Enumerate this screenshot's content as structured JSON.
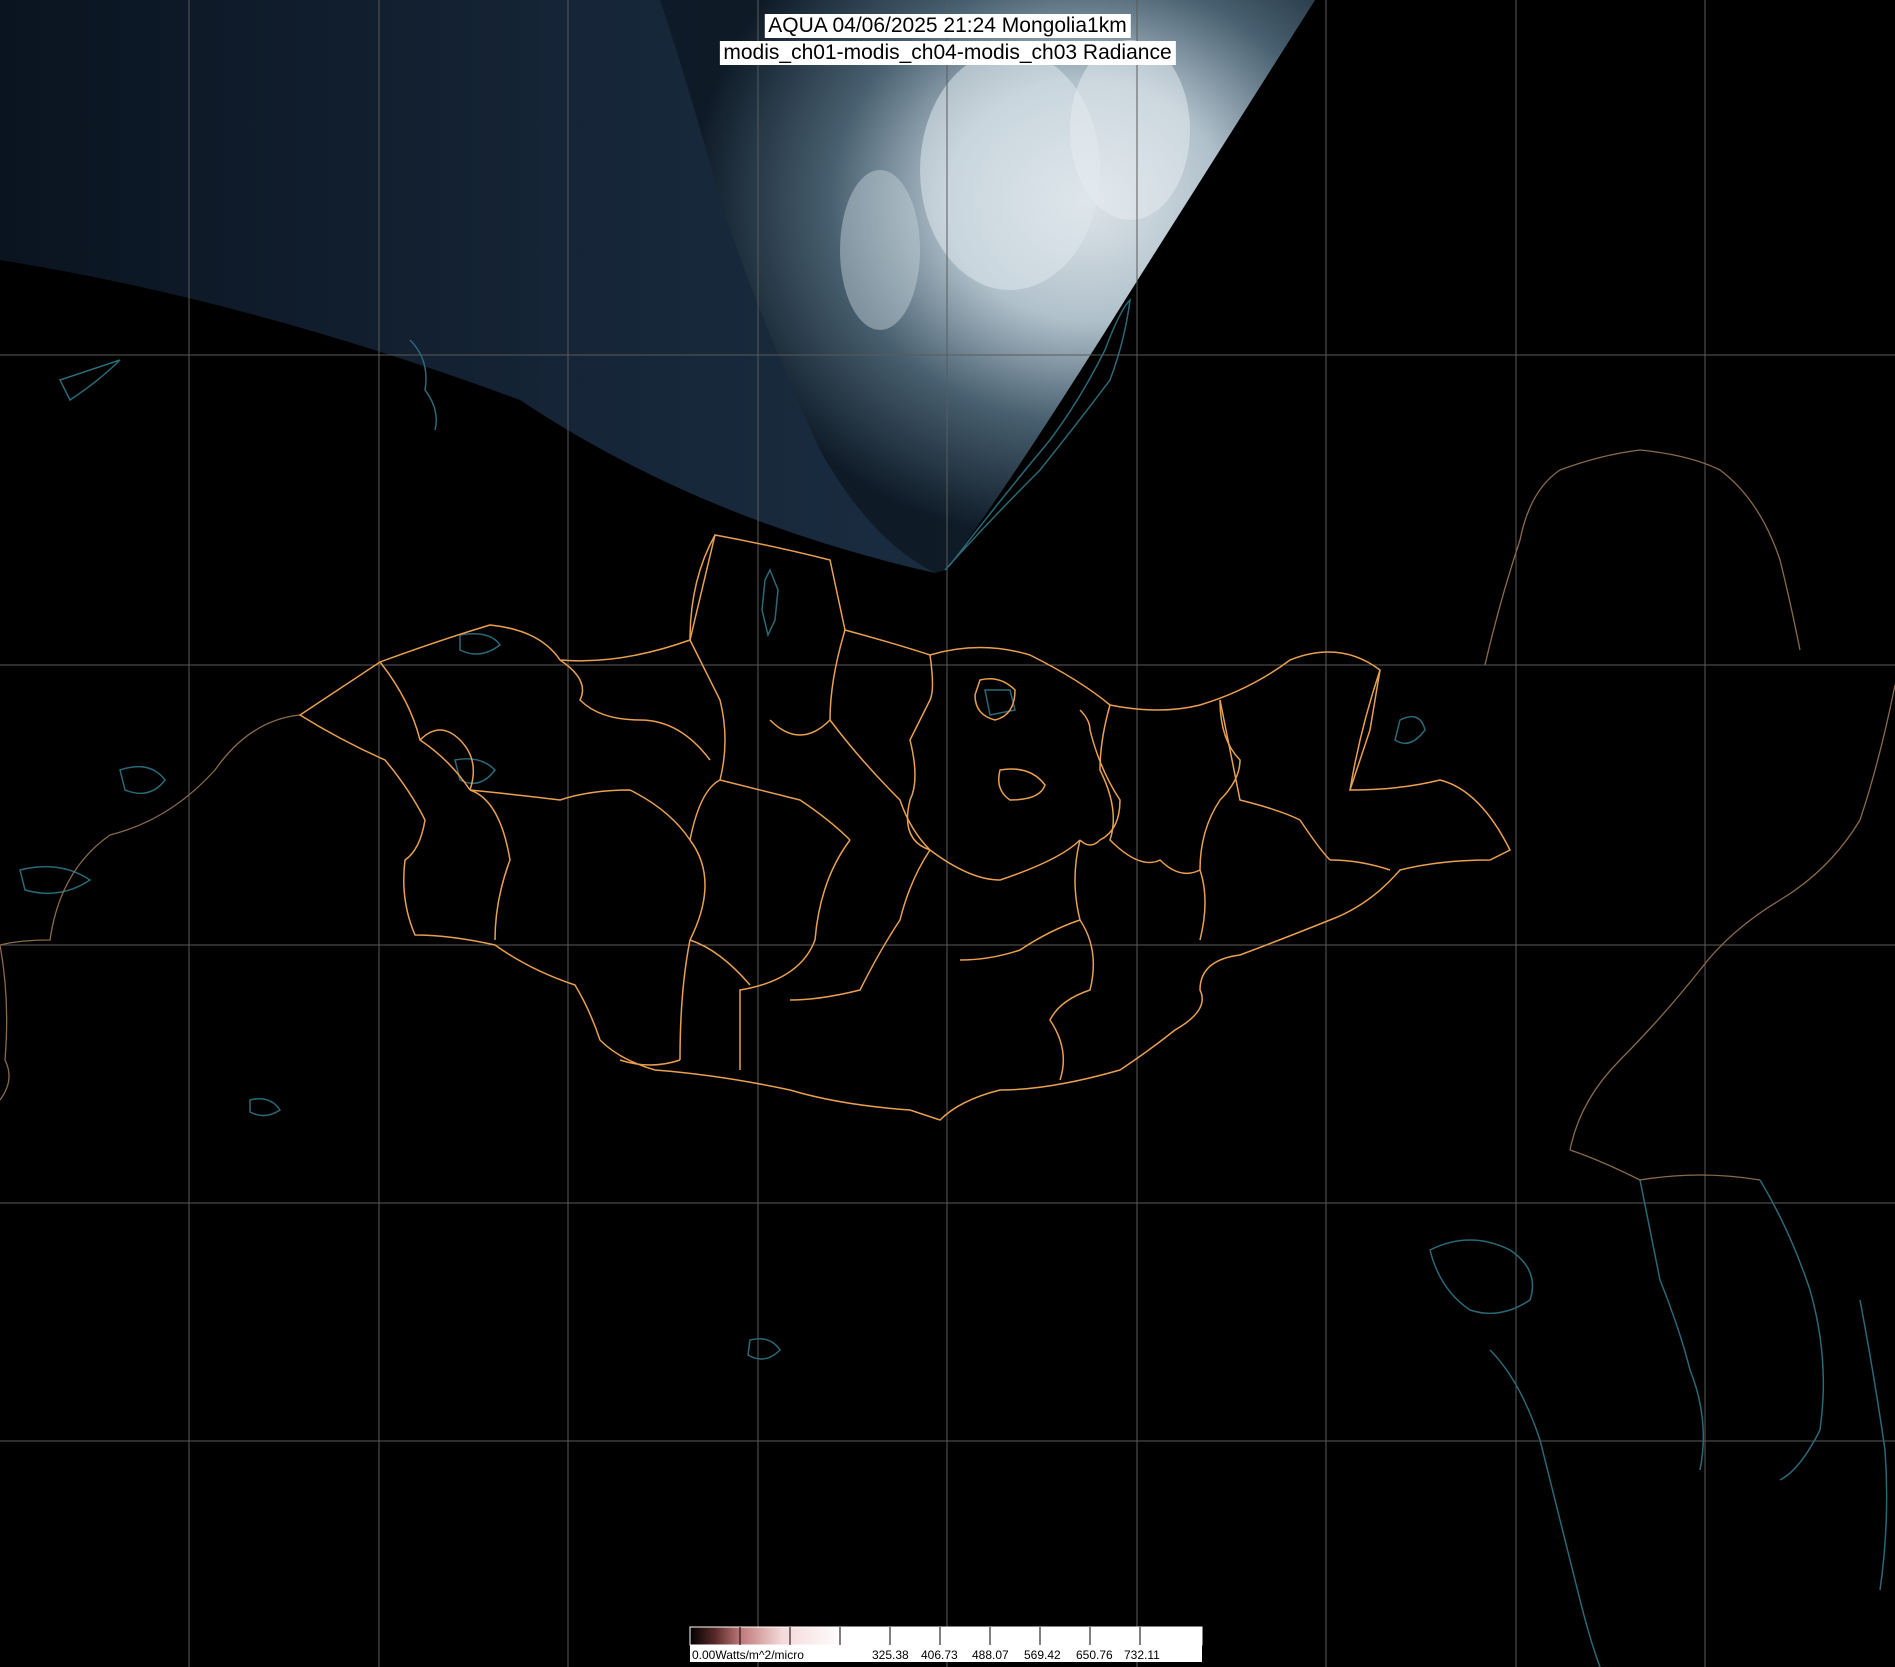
{
  "title": {
    "line1": "AQUA 04/06/2025 21:24 Mongolia1km",
    "line2": "modis_ch01-modis_ch04-modis_ch03 Radiance"
  },
  "colorbar": {
    "labels": [
      "0.00Watts/m^2/micro",
      "325.38",
      "406.73",
      "488.07",
      "569.42",
      "650.76",
      "732.11"
    ],
    "gradient_colors": [
      "#000000",
      "#5a2a2a",
      "#c07a7a",
      "#f4d9d9",
      "#ffffff"
    ]
  },
  "map": {
    "background_color": "#000000",
    "grid_color": "#5a5a5a",
    "province_border_color": "#e8a050",
    "coastline_color": "#2a6878",
    "international_border_color": "#8a6a4a",
    "cloud_swath_color": "#1a2a3a"
  }
}
